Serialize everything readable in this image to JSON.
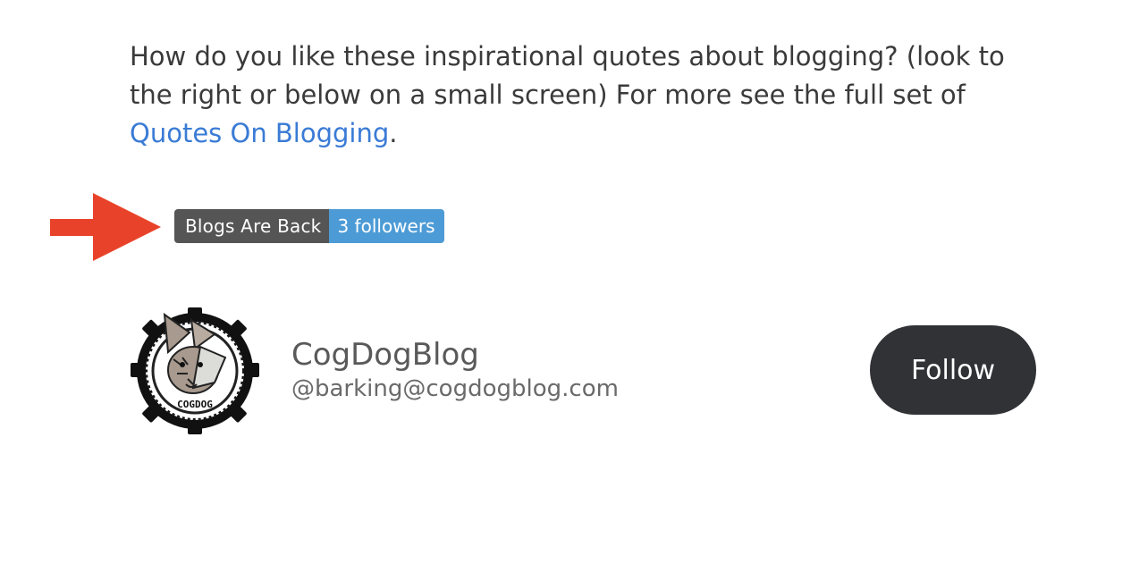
{
  "intro": {
    "text": "How do you like these inspirational quotes about blogging? (look to the right or below on a small screen) For more see the full set of ",
    "link_text": "Quotes On Blogging",
    "trailing": "."
  },
  "badge": {
    "label": "Blogs Are Back",
    "count_label": "3 followers"
  },
  "profile": {
    "name": "CogDogBlog",
    "handle": "@barking@cogdogblog.com",
    "avatar_lettering": "COGDOG",
    "follow_label": "Follow"
  },
  "colors": {
    "link": "#3a7bd5",
    "arrow": "#e8432a",
    "badge_left": "#555555",
    "badge_right": "#4c9bd6",
    "follow_bg": "#303236"
  }
}
